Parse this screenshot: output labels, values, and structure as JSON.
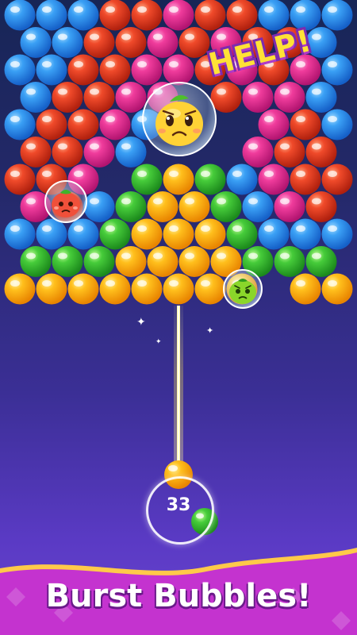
{
  "game": {
    "help_text": "HELP!",
    "shots_remaining": "33",
    "current_bubble": "orange",
    "next_bubble": "green"
  },
  "banner": {
    "title": "Burst Bubbles!"
  },
  "colors": {
    "blue": "#2f8fef",
    "red": "#e8402a",
    "magenta": "#ef3b9a",
    "green": "#3fc63a",
    "orange": "#ffb416",
    "pink_banner": "#d23ad0",
    "gold_trim": "#ffc94a"
  },
  "trapped": [
    {
      "name": "trapped-fruit-orange",
      "emotion": "sad"
    },
    {
      "name": "trapped-fruit-red",
      "emotion": "sad"
    },
    {
      "name": "trapped-fruit-green",
      "emotion": "sad"
    }
  ]
}
